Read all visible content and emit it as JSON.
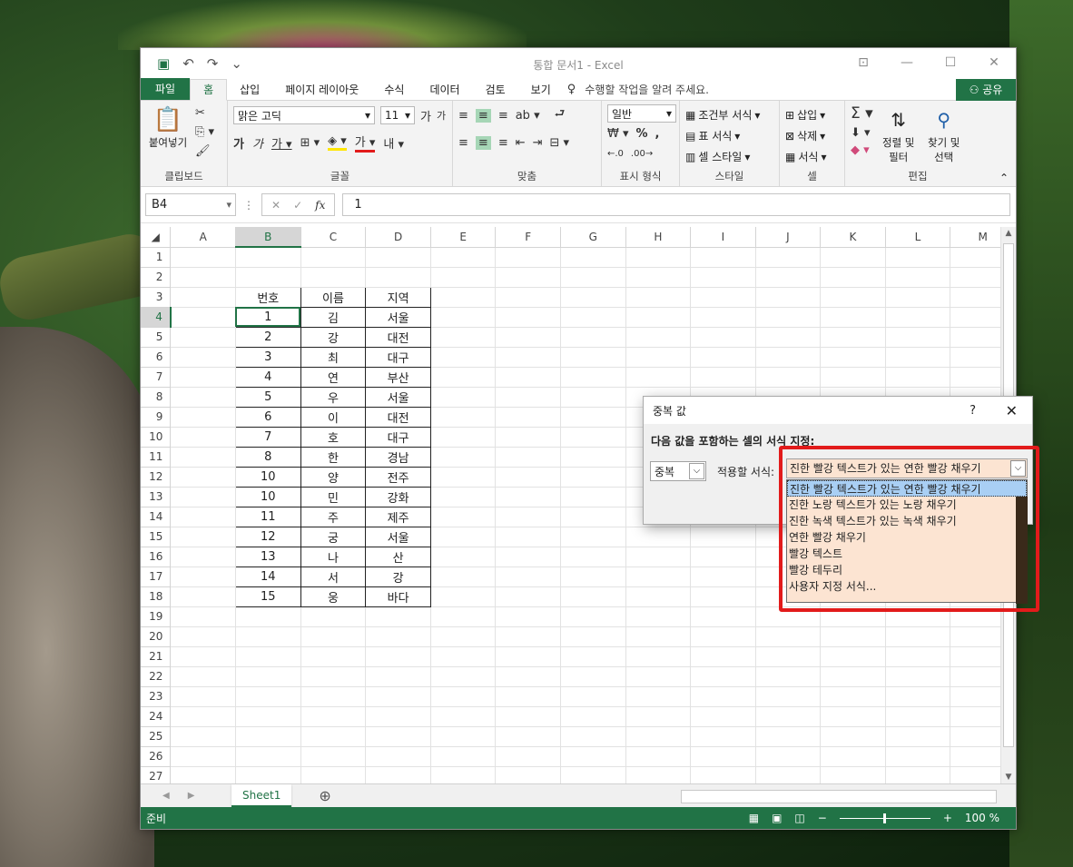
{
  "window": {
    "title": "통합 문서1 - Excel",
    "qat": {
      "undo": "↶",
      "redo": "↷",
      "more": "⌄"
    },
    "controls": [
      "⊡",
      "—",
      "☐",
      "✕"
    ]
  },
  "tabs": [
    {
      "label": "파일"
    },
    {
      "label": "홈"
    },
    {
      "label": "삽입"
    },
    {
      "label": "페이지 레이아웃"
    },
    {
      "label": "수식"
    },
    {
      "label": "데이터"
    },
    {
      "label": "검토"
    },
    {
      "label": "보기"
    }
  ],
  "tellme": "수행할 작업을 알려 주세요.",
  "share": "공유",
  "ribbon": {
    "clipboard": {
      "label": "클립보드",
      "paste": "붙여넣기"
    },
    "font": {
      "label": "글꼴",
      "name": "맑은 고딕",
      "size": "11"
    },
    "alignment": {
      "label": "맞춤"
    },
    "number": {
      "label": "표시 형식",
      "format": "일반"
    },
    "styles": {
      "label": "스타일",
      "cond": "조건부 서식",
      "table": "표 서식",
      "cell": "셀 스타일"
    },
    "cells": {
      "label": "셀",
      "insert": "삽입",
      "delete": "삭제",
      "format": "서식"
    },
    "editing": {
      "label": "편집",
      "sort": "정렬 및",
      "sort2": "필터",
      "find": "찾기 및",
      "find2": "선택"
    }
  },
  "formula_bar": {
    "name_box": "B4",
    "value": "1"
  },
  "columns": [
    "A",
    "B",
    "C",
    "D",
    "E",
    "F",
    "G",
    "H",
    "I",
    "J",
    "K",
    "L",
    "M"
  ],
  "row_numbers": [
    "1",
    "2",
    "3",
    "4",
    "5",
    "6",
    "7",
    "8",
    "9",
    "10",
    "11",
    "12",
    "13",
    "14",
    "15",
    "16",
    "17",
    "18",
    "19",
    "20",
    "21",
    "22",
    "23",
    "24",
    "25",
    "26",
    "27"
  ],
  "table": {
    "headers": [
      "번호",
      "이름",
      "지역"
    ],
    "rows": [
      [
        "1",
        "김",
        "서울"
      ],
      [
        "2",
        "강",
        "대전"
      ],
      [
        "3",
        "최",
        "대구"
      ],
      [
        "4",
        "연",
        "부산"
      ],
      [
        "5",
        "우",
        "서울"
      ],
      [
        "6",
        "이",
        "대전"
      ],
      [
        "7",
        "호",
        "대구"
      ],
      [
        "8",
        "한",
        "경남"
      ],
      [
        "10",
        "양",
        "전주"
      ],
      [
        "10",
        "민",
        "강화"
      ],
      [
        "11",
        "주",
        "제주"
      ],
      [
        "12",
        "궁",
        "서울"
      ],
      [
        "13",
        "나",
        "산"
      ],
      [
        "14",
        "서",
        "강"
      ],
      [
        "15",
        "웅",
        "바다"
      ]
    ]
  },
  "sheet_tab": "Sheet1",
  "status": {
    "ready": "준비",
    "zoom": "100 %"
  },
  "dialog": {
    "title": "중복 값",
    "help": "?",
    "close": "✕",
    "prompt": "다음 값을 포함하는 셀의 서식 지정:",
    "type_value": "중복",
    "apply_label": "적용할 서식:",
    "format_value": "진한 빨강 텍스트가 있는 연한 빨강 채우기",
    "options": [
      "진한 빨강 텍스트가 있는 연한 빨강 채우기",
      "진한 노랑 텍스트가 있는 노랑 채우기",
      "진한 녹색 텍스트가 있는 녹색 채우기",
      "연한 빨강 채우기",
      "빨강 텍스트",
      "빨강 테두리",
      "사용자 지정 서식..."
    ]
  },
  "colors": {
    "excel_green": "#217346",
    "highlight_red": "#e21b1b",
    "list_bg": "#fce4d2"
  }
}
